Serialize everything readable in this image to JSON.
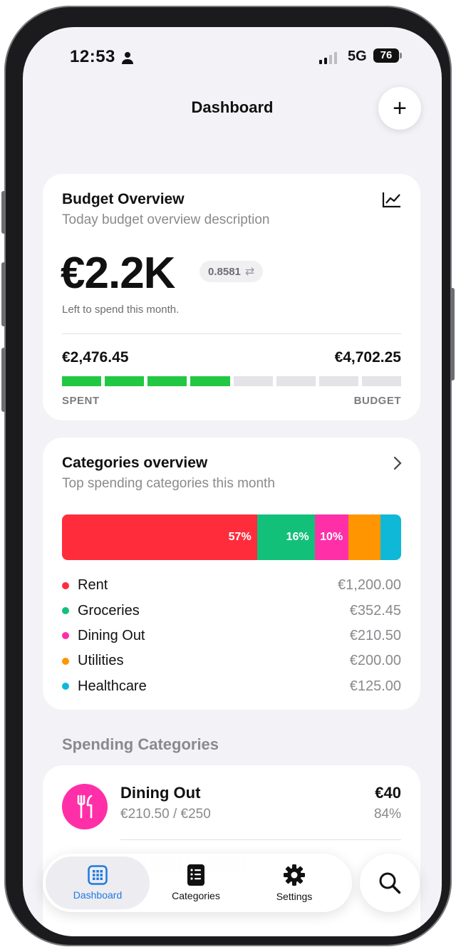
{
  "status_bar": {
    "time": "12:53",
    "network": "5G",
    "battery": "76"
  },
  "header": {
    "title": "Dashboard",
    "add_label": "+"
  },
  "budget_overview": {
    "title": "Budget Overview",
    "subtitle": "Today budget overview description",
    "amount": "€2.2K",
    "rate": "0.8581",
    "left_text": "Left to spend this month.",
    "spent": "€2,476.45",
    "budget": "€4,702.25",
    "spent_label": "SPENT",
    "budget_label": "BUDGET",
    "progress_segments_filled": 4,
    "progress_segments_total": 8,
    "progress_color": "#22c744"
  },
  "categories_overview": {
    "title": "Categories overview",
    "subtitle": "Top spending categories this month",
    "items": [
      {
        "name": "Rent",
        "amount": "€1,200.00",
        "color": "#ff2d3c",
        "share": 57.5,
        "label": "57%"
      },
      {
        "name": "Groceries",
        "amount": "€352.45",
        "color": "#13c07a",
        "share": 17,
        "label": "16%"
      },
      {
        "name": "Dining Out",
        "amount": "€210.50",
        "color": "#ff2fa8",
        "share": 10,
        "label": "10%"
      },
      {
        "name": "Utilities",
        "amount": "€200.00",
        "color": "#ff9500",
        "share": 9.5,
        "label": ""
      },
      {
        "name": "Healthcare",
        "amount": "€125.00",
        "color": "#10b8d8",
        "share": 6,
        "label": ""
      }
    ]
  },
  "spending_categories": {
    "title": "Spending Categories",
    "items": [
      {
        "name": "Dining Out",
        "progress": "€210.50 / €250",
        "left": "€40",
        "percent": "84%",
        "color": "#ff2fa8",
        "icon": "fork-knife-icon"
      }
    ]
  },
  "tab_bar": {
    "tabs": [
      {
        "label": "Dashboard",
        "icon": "grid-icon",
        "active": true
      },
      {
        "label": "Categories",
        "icon": "list-icon",
        "active": false
      },
      {
        "label": "Settings",
        "icon": "gear-icon",
        "active": false
      }
    ],
    "search_icon": "search-icon",
    "accent": "#1f7ae0"
  }
}
